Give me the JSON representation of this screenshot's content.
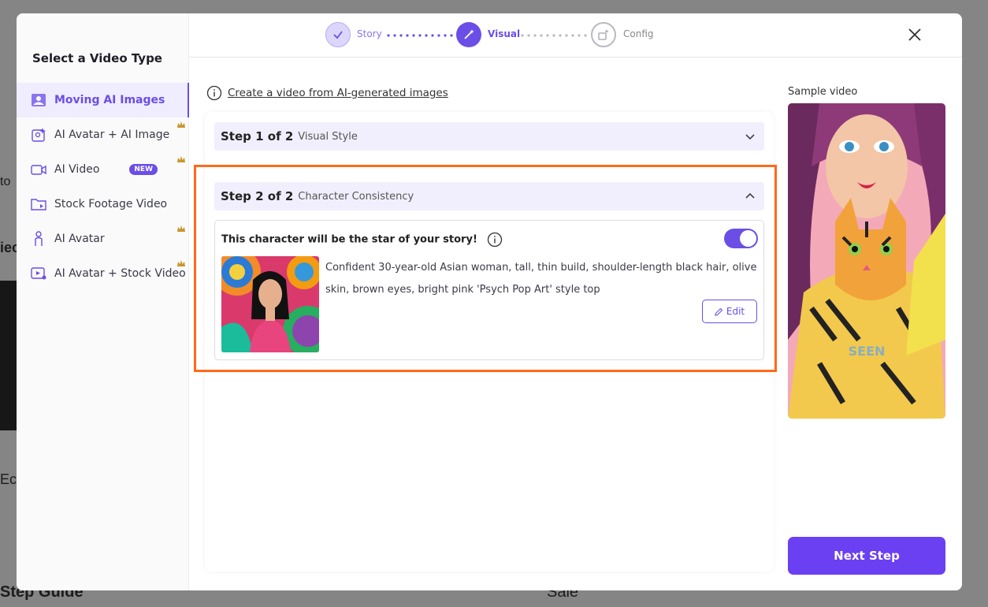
{
  "background": {
    "fragments": [
      "Step Guide",
      "Sale",
      "Ec",
      "iec",
      "to"
    ]
  },
  "sidebar": {
    "title": "Select a Video Type",
    "items": [
      {
        "label": "Moving AI Images",
        "active": true,
        "icon": "image-icon",
        "crown": false
      },
      {
        "label": "AI Avatar + AI Image",
        "active": false,
        "icon": "sparkle-image-icon",
        "crown": true
      },
      {
        "label": "AI Video",
        "active": false,
        "icon": "video-camera-icon",
        "crown": true,
        "badge": "NEW"
      },
      {
        "label": "Stock Footage Video",
        "active": false,
        "icon": "folder-video-icon",
        "crown": false
      },
      {
        "label": "AI Avatar",
        "active": false,
        "icon": "person-icon",
        "crown": true
      },
      {
        "label": "AI Avatar + Stock Video",
        "active": false,
        "icon": "play-avatar-icon",
        "crown": true
      }
    ]
  },
  "stepper": {
    "steps": [
      {
        "label": "Story",
        "state": "done"
      },
      {
        "label": "Visual",
        "state": "current"
      },
      {
        "label": "Config",
        "state": "upcoming"
      }
    ]
  },
  "content": {
    "link": "Create a video from AI-generated images",
    "step1": {
      "title": "Step 1 of 2",
      "subtitle": "Visual Style"
    },
    "step2": {
      "title": "Step 2 of 2",
      "subtitle": "Character Consistency"
    },
    "character": {
      "title": "This character will be the star of your story!",
      "enabled": true,
      "description": "Confident 30-year-old Asian woman, tall, thin build, shoulder-length black hair, olive skin, brown eyes, bright pink 'Psych Pop Art' style top",
      "edit_label": "Edit"
    }
  },
  "sample": {
    "label": "Sample video",
    "watermark": "SEEN"
  },
  "next_label": "Next Step",
  "colors": {
    "accent": "#6b4ee6",
    "button": "#6b3ff2",
    "highlight": "#ff6a1a",
    "active_bg": "#efedff"
  }
}
